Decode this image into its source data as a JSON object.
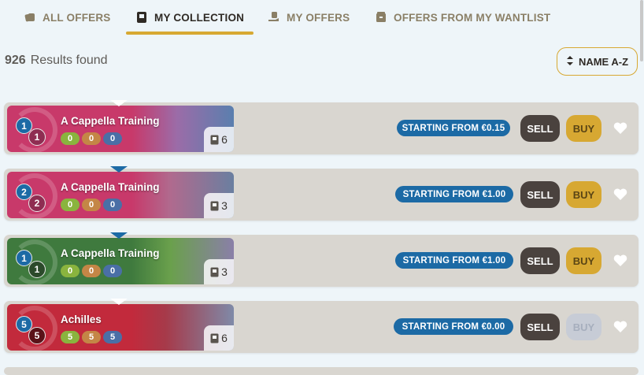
{
  "tabs": [
    {
      "label": "ALL OFFERS",
      "icon": "cards-icon",
      "active": false
    },
    {
      "label": "MY COLLECTION",
      "icon": "book-icon",
      "active": true
    },
    {
      "label": "MY OFFERS",
      "icon": "hand-icon",
      "active": false
    },
    {
      "label": "OFFERS FROM MY WANTLIST",
      "icon": "box-icon",
      "active": false
    }
  ],
  "results": {
    "count": "926",
    "label": "Results found"
  },
  "sort": {
    "label": "NAME A-Z"
  },
  "actions": {
    "sell_label": "SELL",
    "buy_label": "BUY"
  },
  "rows": [
    {
      "name": "A Cappella Training",
      "cost": "1",
      "sub": "1",
      "pills": [
        "0",
        "0",
        "0"
      ],
      "owned": "6",
      "price": "STARTING FROM €0.15",
      "buy_enabled": true,
      "color": "#c8396a",
      "sub_color": "#8f2d52"
    },
    {
      "name": "A Cappella Training",
      "cost": "2",
      "sub": "2",
      "pills": [
        "0",
        "0",
        "0"
      ],
      "owned": "3",
      "price": "STARTING FROM €1.00",
      "buy_enabled": true,
      "color": "#c8396a",
      "sub_color": "#8f2d52"
    },
    {
      "name": "A Cappella Training",
      "cost": "1",
      "sub": "1",
      "pills": [
        "0",
        "0",
        "0"
      ],
      "owned": "3",
      "price": "STARTING FROM €1.00",
      "buy_enabled": true,
      "color": "#3f7a3e",
      "sub_color": "#2c4a2b"
    },
    {
      "name": "Achilles",
      "cost": "5",
      "sub": "5",
      "pills": [
        "5",
        "5",
        "5"
      ],
      "owned": "6",
      "price": "STARTING FROM €0.00",
      "buy_enabled": false,
      "color": "#c22a3c",
      "sub_color": "#5a1218"
    }
  ]
}
